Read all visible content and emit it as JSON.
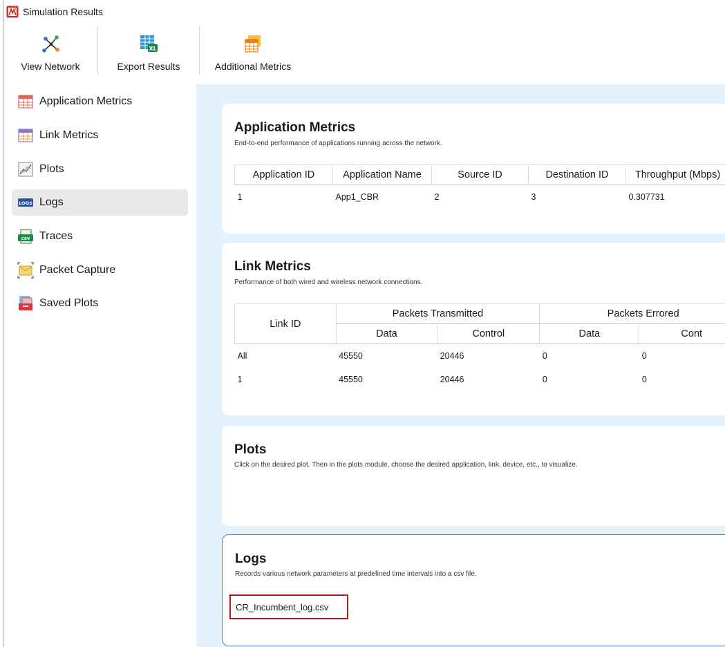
{
  "window": {
    "title": "Simulation Results"
  },
  "toolbar": {
    "view_network": "View Network",
    "export_results": "Export Results",
    "additional_metrics": "Additional Metrics"
  },
  "sidebar": {
    "items": [
      {
        "label": "Application Metrics",
        "icon": "table-icon",
        "active": false
      },
      {
        "label": "Link Metrics",
        "icon": "table-icon",
        "active": false
      },
      {
        "label": "Plots",
        "icon": "chart-icon",
        "active": false
      },
      {
        "label": "Logs",
        "icon": "logs-icon",
        "active": true
      },
      {
        "label": "Traces",
        "icon": "csv-icon",
        "active": false
      },
      {
        "label": "Packet Capture",
        "icon": "envelope-icon",
        "active": false
      },
      {
        "label": "Saved Plots",
        "icon": "saved-plots-icon",
        "active": false
      }
    ]
  },
  "app_metrics": {
    "title": "Application Metrics",
    "description": "End-to-end performance of applications running across the network.",
    "headers": [
      "Application ID",
      "Application Name",
      "Source ID",
      "Destination ID",
      "Throughput (Mbps)"
    ],
    "rows": [
      [
        "1",
        "App1_CBR",
        "2",
        "3",
        "0.307731"
      ]
    ]
  },
  "link_metrics": {
    "title": "Link Metrics",
    "description": "Performance of both wired and wireless network connections.",
    "link_id_header": "Link ID",
    "group_headers": [
      "Packets Transmitted",
      "Packets Errored"
    ],
    "sub_headers": [
      "Data",
      "Control",
      "Data",
      "Cont"
    ],
    "rows": [
      [
        "All",
        "45550",
        "20446",
        "0",
        "0"
      ],
      [
        "1",
        "45550",
        "20446",
        "0",
        "0"
      ]
    ]
  },
  "plots": {
    "title": "Plots",
    "description": "Click on the desired plot. Then in the plots module, choose the desired application, link, device, etc., to visualize."
  },
  "logs": {
    "title": "Logs",
    "description": "Records various network parameters at predefined time intervals into a csv file.",
    "files": [
      "CR_Incumbent_log.csv"
    ]
  },
  "colors": {
    "content_bg": "#e4f2fd",
    "selected_card_border": "#3f86d6",
    "highlight_border": "#a61c1c",
    "active_nav_bg": "#e8e8e8"
  }
}
